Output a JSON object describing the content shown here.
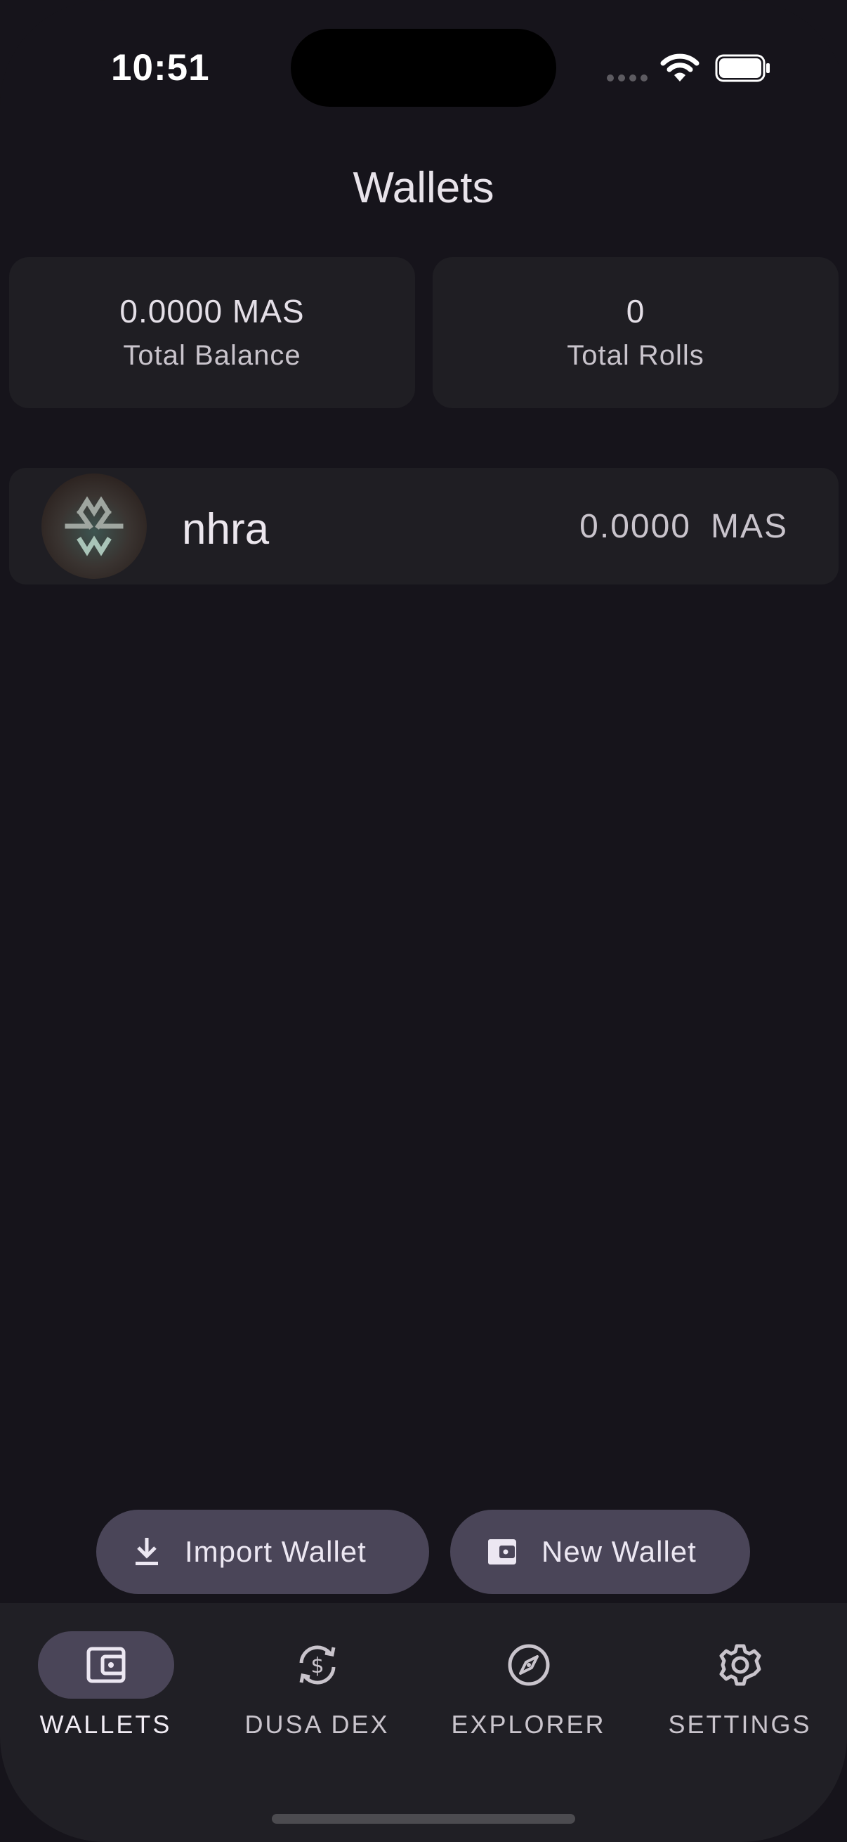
{
  "status_bar": {
    "time": "10:51"
  },
  "header": {
    "title": "Wallets"
  },
  "summary": {
    "total_balance_value": "0.0000 MAS",
    "total_balance_label": "Total Balance",
    "total_rolls_value": "0",
    "total_rolls_label": "Total Rolls"
  },
  "wallets": [
    {
      "name": "nhra",
      "balance": "0.0000",
      "unit": "MAS",
      "icon": "massa-logo-icon"
    }
  ],
  "actions": {
    "import_label": "Import Wallet",
    "import_icon": "download-icon",
    "new_label": "New Wallet",
    "new_icon": "wallet-icon"
  },
  "nav": {
    "items": [
      {
        "label": "WALLETS",
        "icon": "wallet-icon",
        "active": true
      },
      {
        "label": "DUSA DEX",
        "icon": "currency-exchange-icon",
        "active": false
      },
      {
        "label": "EXPLORER",
        "icon": "compass-icon",
        "active": false
      },
      {
        "label": "SETTINGS",
        "icon": "gear-icon",
        "active": false
      }
    ]
  },
  "colors": {
    "background": "#16141b",
    "card": "#1f1e23",
    "accent_pill": "#4a4558",
    "nav_background": "#201f25"
  }
}
